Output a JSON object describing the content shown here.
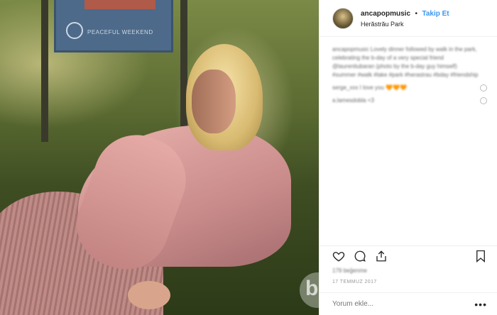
{
  "post": {
    "username": "ancapopmusic",
    "separator": "•",
    "follow_label": "Takip Et",
    "location": "Herăstrău Park"
  },
  "photo": {
    "sign_text": "PEACEFUL WEEKEND"
  },
  "comments": {
    "caption": "ancapopmusic Lovely dinner followed by walk in the park, celebrating the b-day of a very special friend @laurentiubaran (photo by the b-day guy himself) #summer #walk #lake #park #herastrau #bday #friendship",
    "comment_1": "serge_xxx I love you",
    "comment_1_emoji": "🧡🧡🧡",
    "comment_2": "a.lamesdobla <3"
  },
  "actions": {
    "like_icon": "heart-icon",
    "comment_icon": "comment-icon",
    "share_icon": "share-icon",
    "save_icon": "bookmark-icon"
  },
  "likes_text": "179 beğenme",
  "date_text": "17 TEMMUZ 2017",
  "comment_placeholder": "Yorum ekle...",
  "more_label": "•••"
}
